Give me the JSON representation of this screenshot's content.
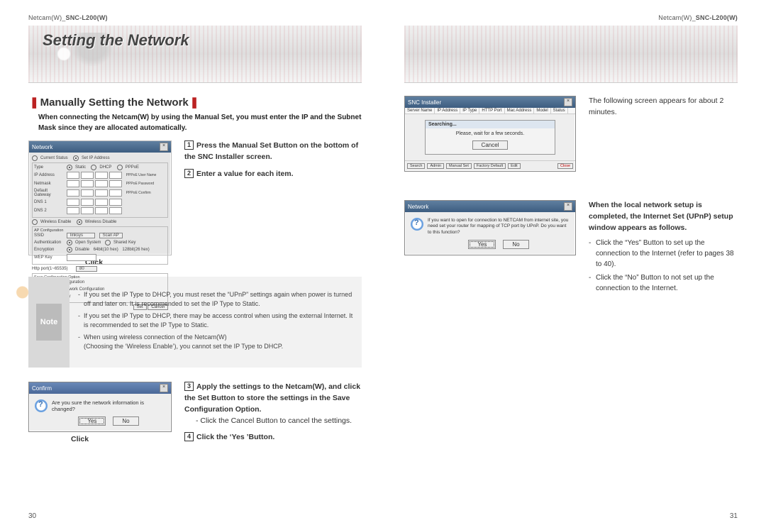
{
  "header": {
    "brand": "Netcam(W)",
    "model": "SNC-L200(W)"
  },
  "banner": {
    "title": "Setting the Network"
  },
  "left": {
    "section_title": "Manually Setting the Network",
    "intro": "When connecting the Netcam(W) by using the Manual Set, you must enter the IP and the Subnet Mask since they are allocated automatically.",
    "steps": {
      "s1": "Press the Manual Set Button on the bottom of the SNC Installer screen.",
      "s2": "Enter a value for each item.",
      "s3": "Apply the settings to the Netcam(W), and click the Set Button to store the settings in the Save Configuration Option.",
      "s3_sub": "Click the Cancel Button to cancel the settings.",
      "s4": "Click the ‘Yes ’Button."
    },
    "shot1": {
      "title": "Network",
      "tab1": "Current Status",
      "tab2": "Set IP Address",
      "type_label": "Type",
      "type_static": "Static",
      "type_dhcp": "DHCP",
      "type_pppoe": "PPPoE",
      "ip_label": "IP Address",
      "netmask_label": "Netmask",
      "gateway_label": "Default Gateway",
      "dns1_label": "DNS 1",
      "dns2_label": "DNS 2",
      "ppp_user": "PPPoE User Name",
      "ppp_pass": "PPPoE Password",
      "ppp_conf": "PPPoE Confirm",
      "wl_enable": "Wireless Enable",
      "wl_disable": "Wireless Disable",
      "ap_config": "AP Configuration",
      "ssid": "SSID",
      "ssid_val": "linksys",
      "scan": "Scan AP",
      "auth": "Authentication",
      "auth_open": "Open System",
      "auth_shared": "Shared Key",
      "enc": "Encryption",
      "enc_dis": "Disable",
      "enc_64": "64bit(10 hex)",
      "enc_128": "128bit(26 hex)",
      "wep": "WEP Key",
      "httpport": "Http port(1~65535)",
      "httpport_val": "80",
      "save_opt": "Save Configuration Option",
      "save_all": "Save All Configuration",
      "save_http": "Save Http Network Configuration",
      "save_none": "Don't save any",
      "set": "Set",
      "cancel": "Cancel"
    },
    "click_label": "Click",
    "note_label": "Note",
    "note": {
      "n1": "If you set the IP Type to DHCP, you must reset the “UPnP” settings again when power is turned off and later on. It is recommended to set the IP Type to Static.",
      "n2": "If you set the IP Type to DHCP, there may be access control when using the external Internet. It is recommended to set the IP Type to Static.",
      "n3a": "When using wireless connection of the Netcam(W)",
      "n3b": "(Choosing the ‘Wireless Enable’), you cannot set the IP Type to DHCP."
    },
    "confirm": {
      "title": "Confirm",
      "msg": "Are you sure the network information is changed?",
      "yes": "Yes",
      "no": "No"
    },
    "page_no": "30"
  },
  "right": {
    "line1": "The following screen appears for about 2 minutes.",
    "search": {
      "title": "SNC Installer",
      "cols": [
        "Server Name",
        "IP Address",
        "IP Type",
        "HTTP Port",
        "Mac Address",
        "Model",
        "Status"
      ],
      "popup_title": "Searching...",
      "popup_msg": "Please, wait for a few seconds.",
      "cancel": "Cancel",
      "btns": [
        "Search",
        "Admin",
        "Manual Set",
        "Factory Default",
        "Edit",
        "Close"
      ]
    },
    "upnp_intro": "When the local network setup is completed, the Internet Set (UPnP) setup window appears as follows.",
    "upnp_items": {
      "i1": "Click the “Yes” Button to set up the connection to the Internet (refer to pages 38 to 40).",
      "i2": "Click the “No” Button to not set up the connection to the Internet."
    },
    "netdlg": {
      "title": "Network",
      "msg": "If you want to open for connection to NETCAM from internet site, you need set your router for mapping of TCP port by UPnP. Do you want to this function?",
      "yes": "Yes",
      "no": "No"
    },
    "page_no": "31"
  }
}
